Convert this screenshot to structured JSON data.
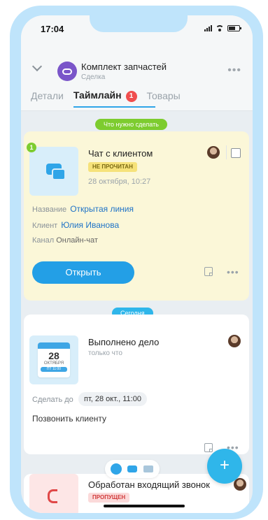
{
  "status_bar": {
    "time": "17:04"
  },
  "header": {
    "title": "Комплект запчастей",
    "subtitle": "Сделка",
    "more": "•••"
  },
  "tabs": [
    {
      "label": "Детали",
      "active": false
    },
    {
      "label": "Таймлайн",
      "active": true,
      "badge": "1"
    },
    {
      "label": "Товары",
      "active": false
    }
  ],
  "sections": {
    "todo_label": "Что нужно сделать",
    "today_label": "Сегодня"
  },
  "chat_card": {
    "counter": "1",
    "title": "Чат с клиентом",
    "status": "НЕ ПРОЧИТАН",
    "date": "28 октября, 10:27",
    "fields": [
      {
        "label": "Название",
        "value": "Открытая линия"
      },
      {
        "label": "Клиент",
        "value": "Юлия Иванова"
      },
      {
        "label": "Канал",
        "value": "Онлайн-чат"
      }
    ],
    "open_button": "Открыть",
    "more": "•••"
  },
  "task_card": {
    "title": "Выполнено дело",
    "subtitle": "только что",
    "calendar": {
      "day": "28",
      "month": "ОКТЯБРЯ",
      "time": "ПТ 11:00"
    },
    "due_label": "Сделать до",
    "due_value": "пт, 28 окт., 11:00",
    "text": "Позвонить клиенту",
    "more": "•••"
  },
  "call_card": {
    "title": "Обработан входящий звонок",
    "status": "ПРОПУЩЕН"
  },
  "fab": {
    "label": "+"
  },
  "colors": {
    "accent": "#2fa5e8",
    "todo_pill": "#7dcc2f",
    "today_pill": "#2fb6ea",
    "unread_chip": "#f6e27a",
    "missed_chip": "#fbdada"
  }
}
